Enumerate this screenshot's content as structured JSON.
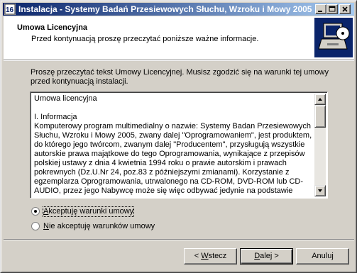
{
  "window": {
    "title": "Instalacja - Systemy Badań Przesiewowych Słuchu, Wzroku i Mowy 2005"
  },
  "header": {
    "title": "Umowa Licencyjna",
    "subtitle": "Przed kontynuacją proszę przeczytać poniższe ważne informacje."
  },
  "instructions": "Proszę przeczytać tekst Umowy Licencyjnej. Musisz zgodzić się na warunki tej umowy przed kontynuacją instalacji.",
  "license_text": "Umowa licencyjna\n\nI.  Informacja\nKomputerowy program multimedialny o nazwie: Systemy Badan Przesiewowych Słuchu, Wzroku i Mowy 2005, zwany dalej \"Oprogramowaniem\", jest produktem, do którego jego twórcom, zwanym dalej \"Producentem\", przysługują wszystkie autorskie prawa majątkowe do tego Oprogramowania, wynikające z przepisów polskiej ustawy z dnia 4 kwietnia 1994 roku o prawie autorskim i prawach pokrewnych (Dz.U.Nr 24, poz.83 z późniejszymi zmianami). Korzystanie z egzemplarza  Oprogramowania, utrwalonego na CD-ROM, DVD-ROM lub CD-AUDIO, przez jego Nabywcę może się więc odbywać jedynie na podstawie",
  "options": {
    "accept": {
      "mnemonic": "A",
      "rest": "kceptuję warunki umowy",
      "selected": true
    },
    "decline": {
      "mnemonic": "N",
      "rest": "ie akceptuję warunków umowy",
      "selected": false
    }
  },
  "buttons": {
    "back": {
      "prefix": "< ",
      "mnemonic": "W",
      "rest": "stecz"
    },
    "next": {
      "mnemonic": "D",
      "rest": "alej >"
    },
    "cancel": {
      "label": "Anuluj"
    }
  },
  "colors": {
    "titlebar_start": "#0a246a",
    "titlebar_end": "#a6caf0",
    "face": "#d4d0c8"
  }
}
